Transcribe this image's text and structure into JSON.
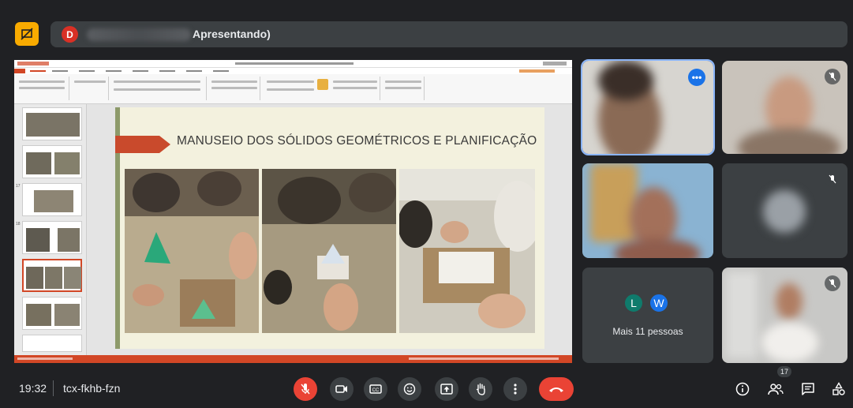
{
  "top_bar": {
    "presenter_initial": "D",
    "presenting_label": "Apresentando)"
  },
  "slide": {
    "title": "MANUSEIO DOS SÓLIDOS GEOMÉTRICOS E PLANIFICAÇÃO"
  },
  "thumbnail_numbers": [
    "",
    "",
    "",
    "17",
    "18",
    "",
    "",
    ""
  ],
  "participants": {
    "more_label": "Mais 11 pessoas",
    "avatars": [
      {
        "initial": "L",
        "color": "#0f7b6c"
      },
      {
        "initial": "W",
        "color": "#1a73e8"
      }
    ],
    "count": "17"
  },
  "bottom_bar": {
    "time": "19:32",
    "meeting_code": "tcx-fkhb-fzn"
  },
  "colors": {
    "accent_blue": "#8ab4f8",
    "hangup_red": "#ea4335",
    "present_yellow": "#f9ab00",
    "ppt_orange": "#d24726"
  }
}
